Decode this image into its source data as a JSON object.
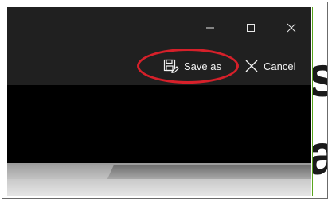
{
  "window": {
    "caption_buttons": {
      "minimize_icon": "minimize-icon",
      "maximize_icon": "maximize-icon",
      "close_icon": "close-icon"
    },
    "commands": {
      "save_as_label": "Save as",
      "save_as_icon": "save-as-icon",
      "cancel_label": "Cancel",
      "cancel_icon": "cancel-x-icon"
    }
  },
  "background_text": {
    "char_top": "s",
    "char_bottom": "a"
  },
  "colors": {
    "titlebar": "#202020",
    "highlight_ring": "#d6202a",
    "frame_accent": "#5aa51e"
  }
}
